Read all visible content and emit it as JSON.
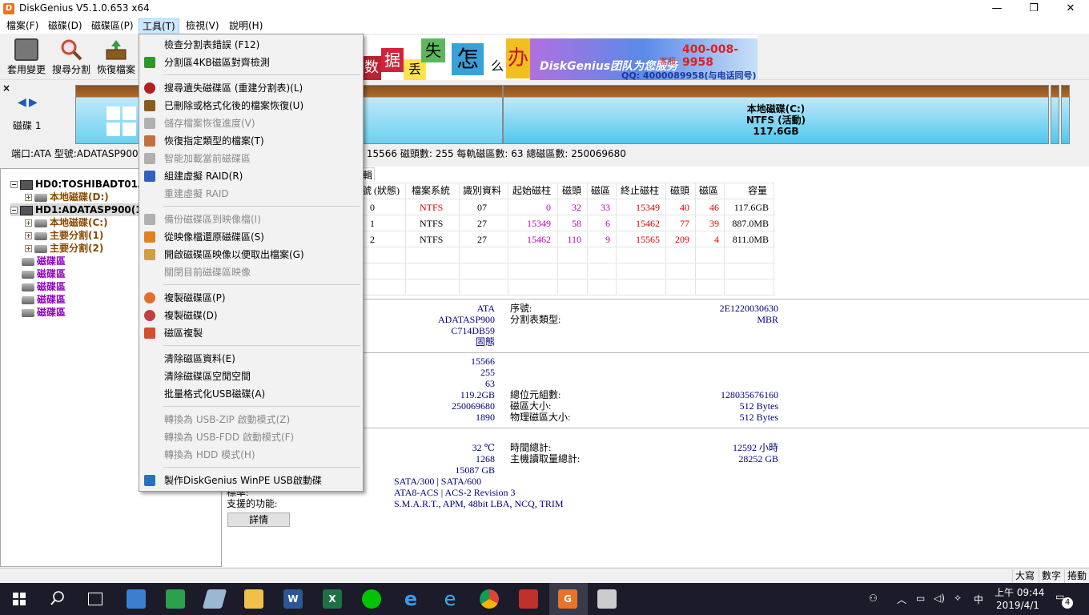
{
  "window": {
    "title": "DiskGenius V5.1.0.653 x64",
    "app_icon": "D",
    "minimize": "—",
    "maximize": "❐",
    "close": "✕"
  },
  "menubar": [
    "檔案(F)",
    "磁碟(D)",
    "磁碟區(P)",
    "工具(T)",
    "檢視(V)",
    "說明(H)"
  ],
  "toolbar": {
    "buttons": [
      "套用變更",
      "搜尋分割",
      "恢復檔案"
    ]
  },
  "banner": {
    "chars": [
      "数",
      "据",
      "丢",
      "失",
      "怎",
      "么",
      "办"
    ],
    "slogan": "DiskGenius团队为您服务",
    "phone": "400-008-9958",
    "phone_label": "客服:",
    "qq": "QQ: 4000089958(与电话同号)"
  },
  "diskbar": {
    "disk_label": "磁碟 1",
    "close": "×",
    "partition_name": "本地磁碟(C:)",
    "partition_fs": "NTFS (活動)",
    "partition_size": "117.6GB"
  },
  "infoline": {
    "left": "端口:ATA  型號:ADATASP900",
    "right": ": 15566  磁頭數: 255  每軌磁區數: 63  總磁區數: 250069680"
  },
  "tree": [
    {
      "text": "HD0:TOSHIBADT01A",
      "level": 0,
      "style": "bold"
    },
    {
      "text": "本地磁碟(D:)",
      "level": 1,
      "style": "brown"
    },
    {
      "text": "HD1:ADATASP900(11",
      "level": 0,
      "style": "bold"
    },
    {
      "text": "本地磁碟(C:)",
      "level": 1,
      "style": "brown"
    },
    {
      "text": "主要分割(1)",
      "level": 1,
      "style": "brown"
    },
    {
      "text": "主要分割(2)",
      "level": 1,
      "style": "brown"
    },
    {
      "text": "磁碟區",
      "level": 0,
      "style": "purple"
    },
    {
      "text": "磁碟區",
      "level": 0,
      "style": "purple"
    },
    {
      "text": "磁碟區",
      "level": 0,
      "style": "purple"
    },
    {
      "text": "磁碟區",
      "level": 0,
      "style": "purple"
    },
    {
      "text": "磁碟區",
      "level": 0,
      "style": "purple"
    }
  ],
  "tab_partial": "輯",
  "partition_table": {
    "headers": [
      "號 (狀態)",
      "檔案系統",
      "識別資料",
      "起始磁柱",
      "磁頭",
      "磁區",
      "終止磁柱",
      "磁頭",
      "磁區",
      "容量"
    ],
    "rows": [
      [
        "0",
        "NTFS",
        "07",
        "0",
        "32",
        "33",
        "15349",
        "40",
        "46",
        "117.6GB"
      ],
      [
        "1",
        "NTFS",
        "27",
        "15349",
        "58",
        "6",
        "15462",
        "77",
        "39",
        "887.0MB"
      ],
      [
        "2",
        "NTFS",
        "27",
        "15462",
        "110",
        "9",
        "15565",
        "209",
        "4",
        "811.0MB"
      ]
    ]
  },
  "details": {
    "values_left": [
      "ATA",
      "ADATASP900",
      "C714DB59",
      "固態"
    ],
    "labels_mid": [
      "序號:",
      "分割表類型:"
    ],
    "values_right": [
      "2E1220030630",
      "MBR"
    ],
    "geo_left": [
      "15566",
      "255",
      "63",
      "119.2GB",
      "250069680",
      "1890"
    ],
    "geo_labels": [
      "總位元組數:",
      "磁區大小:",
      "物理磁區大小:"
    ],
    "geo_right": [
      "128035676160",
      "512 Bytes",
      "512 Bytes"
    ],
    "smart_left": [
      "32 ℃",
      "1268",
      "15087 GB"
    ],
    "smart_labels": [
      "時間總計:",
      "主機讀取量總計:"
    ],
    "smart_right": [
      "12592 小時",
      "28252 GB"
    ],
    "std_rows": [
      {
        "label": "",
        "value": "SATA/300 | SATA/600"
      },
      {
        "label": "標準:",
        "value": "ATA8-ACS | ACS-2 Revision 3"
      },
      {
        "label": "支援的功能:",
        "value": "S.M.A.R.T., APM, 48bit LBA, NCQ, TRIM"
      }
    ],
    "details_button": "詳情"
  },
  "dropdown": [
    {
      "label": "檢查分割表錯誤 (F12)",
      "enabled": true
    },
    {
      "label": "分割區4KB磁區對齊檢測",
      "enabled": true,
      "icon": "align-icon",
      "color": "#2a9a2a"
    },
    {
      "sep": true
    },
    {
      "label": "搜尋遺失磁碟區 (重建分割表)(L)",
      "enabled": true,
      "icon": "search-icon",
      "color": "#b02020"
    },
    {
      "label": "已刪除或格式化後的檔案恢復(U)",
      "enabled": true,
      "icon": "recover-icon",
      "color": "#8a5a20"
    },
    {
      "label": "儲存檔案恢復進度(V)",
      "enabled": false,
      "icon": "save-icon",
      "color": "#b0b0b0"
    },
    {
      "label": "恢復指定類型的檔案(T)",
      "enabled": true,
      "icon": "filetype-icon",
      "color": "#c07040"
    },
    {
      "label": "智能加載當前磁碟區",
      "enabled": false,
      "icon": "load-icon",
      "color": "#b0b0b0"
    },
    {
      "label": "組建虛擬 RAID(R)",
      "enabled": true,
      "icon": "raid-icon",
      "color": "#3060c0"
    },
    {
      "label": "重建虛擬 RAID",
      "enabled": false
    },
    {
      "sep": true
    },
    {
      "label": "備份磁碟區到映像檔(I)",
      "enabled": false,
      "icon": "backup-icon",
      "color": "#b0b0b0"
    },
    {
      "label": "從映像檔還原磁碟區(S)",
      "enabled": true,
      "icon": "restore-icon",
      "color": "#e08020"
    },
    {
      "label": "開啟磁碟區映像以便取出檔案(G)",
      "enabled": true,
      "icon": "open-image-icon",
      "color": "#d0a040"
    },
    {
      "label": "關閉目前磁碟區映像",
      "enabled": false
    },
    {
      "sep": true
    },
    {
      "label": "複製磁碟區(P)",
      "enabled": true,
      "icon": "clone-partition-icon",
      "color": "#e07030"
    },
    {
      "label": "複製磁碟(D)",
      "enabled": true,
      "icon": "clone-disk-icon",
      "color": "#c04040"
    },
    {
      "label": "磁區複製",
      "enabled": true,
      "icon": "sector-copy-icon",
      "color": "#d05030"
    },
    {
      "sep": true
    },
    {
      "label": "清除磁區資料(E)",
      "enabled": true
    },
    {
      "label": "清除磁碟區空閒空間",
      "enabled": true
    },
    {
      "label": "批量格式化USB磁碟(A)",
      "enabled": true
    },
    {
      "sep": true
    },
    {
      "label": "轉換為 USB-ZIP 啟動模式(Z)",
      "enabled": false
    },
    {
      "label": "轉換為 USB-FDD 啟動模式(F)",
      "enabled": false
    },
    {
      "label": "轉換為 HDD 模式(H)",
      "enabled": false
    },
    {
      "sep": true
    },
    {
      "label": "製作DiskGenius WinPE USB啟動碟",
      "enabled": true,
      "icon": "usb-icon",
      "color": "#2a70c0"
    }
  ],
  "statusbar": [
    "大寫",
    "數字",
    "捲動"
  ],
  "taskbar": {
    "time": "上午 09:44",
    "date": "2019/4/1",
    "ime": "中",
    "notifications": "4"
  }
}
